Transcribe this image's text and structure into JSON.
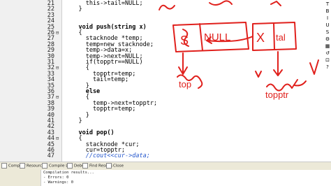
{
  "editor": {
    "lines": [
      {
        "n": "21",
        "fold": "",
        "code": "      this->tail=NULL;"
      },
      {
        "n": "22",
        "fold": "",
        "code": "    }"
      },
      {
        "n": "23",
        "fold": "",
        "code": ""
      },
      {
        "n": "24",
        "fold": "",
        "code": ""
      },
      {
        "n": "25",
        "fold": "",
        "code": "    void push(string x)"
      },
      {
        "n": "26",
        "fold": "⊟",
        "code": "    {"
      },
      {
        "n": "27",
        "fold": "",
        "code": "      stacknode *temp;"
      },
      {
        "n": "28",
        "fold": "",
        "code": "      temp=new stacknode;"
      },
      {
        "n": "29",
        "fold": "",
        "code": "      temp->data=x;"
      },
      {
        "n": "30",
        "fold": "",
        "code": "      temp->next=NULL;"
      },
      {
        "n": "31",
        "fold": "",
        "code": "      if(topptr==NULL)"
      },
      {
        "n": "32",
        "fold": "⊟",
        "code": "      {"
      },
      {
        "n": "33",
        "fold": "",
        "code": "        topptr=temp;"
      },
      {
        "n": "34",
        "fold": "",
        "code": "        tail=temp;"
      },
      {
        "n": "35",
        "fold": "",
        "code": "      }"
      },
      {
        "n": "36",
        "fold": "",
        "code": "      else"
      },
      {
        "n": "37",
        "fold": "⊟",
        "code": "      {"
      },
      {
        "n": "38",
        "fold": "",
        "code": "        temp->next=topptr;"
      },
      {
        "n": "39",
        "fold": "",
        "code": "        topptr=temp;"
      },
      {
        "n": "40",
        "fold": "",
        "code": "      }"
      },
      {
        "n": "41",
        "fold": "",
        "code": "    }"
      },
      {
        "n": "42",
        "fold": "",
        "code": ""
      },
      {
        "n": "43",
        "fold": "",
        "code": "    void pop()"
      },
      {
        "n": "44",
        "fold": "⊟",
        "code": "    {"
      },
      {
        "n": "45",
        "fold": "",
        "code": "      stacknode *cur;"
      },
      {
        "n": "46",
        "fold": "",
        "code": "      cur=topptr;"
      },
      {
        "n": "47",
        "fold": "",
        "code": "      //cout<<cur->data;"
      }
    ]
  },
  "toolbar": {
    "buttons": [
      "T",
      "B",
      "I",
      "U",
      "S",
      "⚙",
      "▦",
      "↺",
      "⊡",
      "?"
    ]
  },
  "annotations": {
    "node1_data": "NULL",
    "node1_ptr": "S",
    "node2_data": "X",
    "node2_ptr": "tal",
    "top_label": "top",
    "topptr_label": "topptr",
    "colors": {
      "ink": "#e0201c"
    }
  },
  "tabs": [
    {
      "label": "Compiler",
      "icon": "compiler-icon"
    },
    {
      "label": "Resources",
      "icon": "resources-icon"
    },
    {
      "label": "Compile Log",
      "icon": "compile-log-icon"
    },
    {
      "label": "Debug",
      "icon": "debug-icon"
    },
    {
      "label": "Find Results",
      "icon": "find-results-icon"
    },
    {
      "label": "Close",
      "icon": "close-icon"
    }
  ],
  "log": {
    "lines": [
      "Compilation results...",
      "- Errors: 0",
      "- Warnings: 0"
    ]
  }
}
